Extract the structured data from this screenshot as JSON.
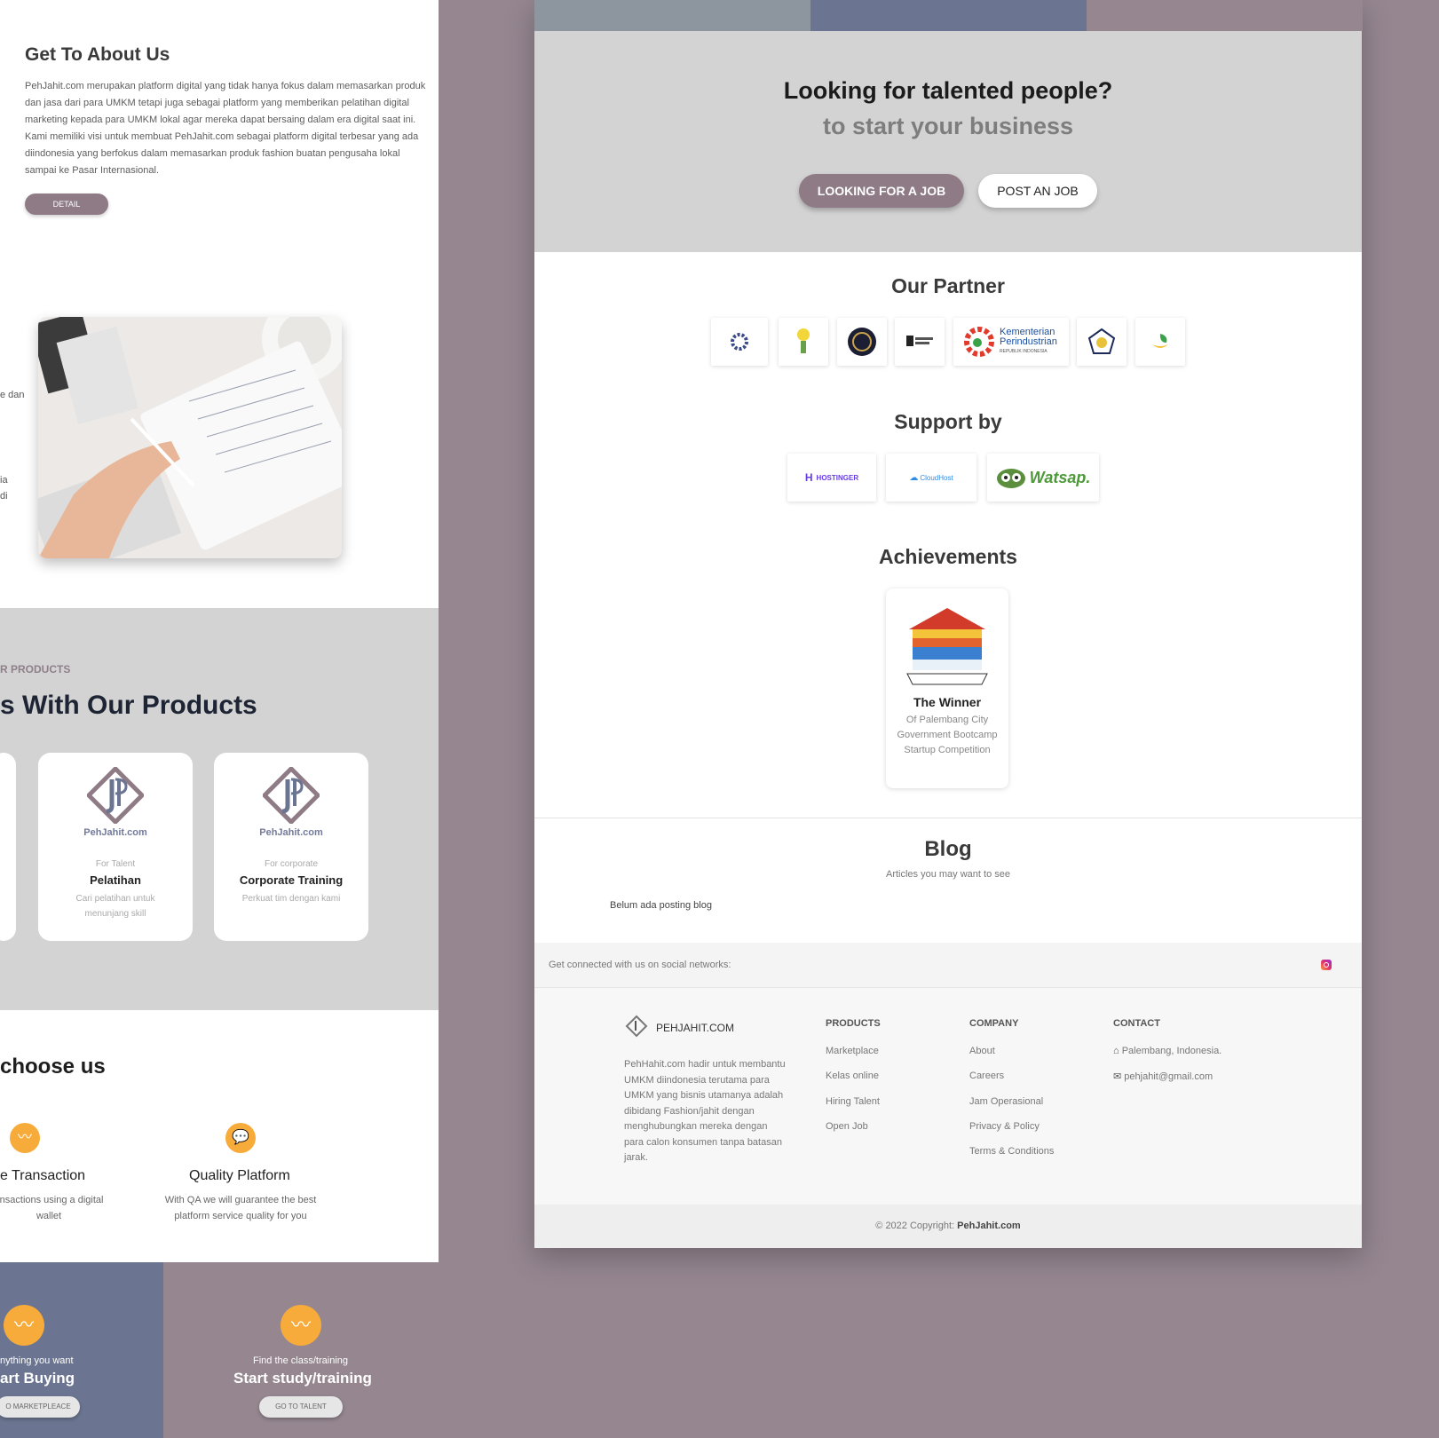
{
  "about": {
    "title": "Get To About Us",
    "text": "PehJahit.com merupakan platform digital yang tidak hanya fokus dalam memasarkan produk dan jasa dari para UMKM tetapi juga sebagai platform yang memberikan pelatihan digital marketing kepada para UMKM lokal agar mereka dapat bersaing dalam era digital saat ini. Kami memiliki visi untuk membuat PehJahit.com sebagai platform digital terbesar yang ada diindonesia yang berfokus dalam memasarkan produk fashion buatan pengusaha lokal sampai ke Pasar Internasional.",
    "detail_button": "DETAIL",
    "fragments": [
      "e dan",
      "ia",
      "di"
    ]
  },
  "products": {
    "eyebrow": "R PRODUCTS",
    "heading": "s With Our Products",
    "cards": [
      {
        "brand": "PehJahit.com",
        "kicker": "For Talent",
        "title": "Pelatihan",
        "desc": "Cari pelatihan untuk menunjang skill"
      },
      {
        "brand": "PehJahit.com",
        "kicker": "For corporate",
        "title": "Corporate Training",
        "desc": "Perkuat tim dengan kami"
      }
    ]
  },
  "why": {
    "heading": "choose us",
    "features": [
      {
        "title": "e Transaction",
        "desc": "ansactions using a digital wallet"
      },
      {
        "title": "Quality Platform",
        "desc": "With QA we will guarantee the best platform service quality for you"
      }
    ]
  },
  "cta": [
    {
      "small": "nything you want",
      "big": "art Buying",
      "button": "O MARKETPLEACE"
    },
    {
      "small": "Find the class/training",
      "big": "Start study/training",
      "button": "GO TO TALENT"
    }
  ],
  "hero": {
    "title": "Looking for talented people?",
    "subtitle": "to start your business",
    "btn_job": "LOOKING FOR A JOB",
    "btn_post": "POST AN JOB"
  },
  "partner": {
    "heading": "Our Partner",
    "kementerian_line1": "Kementerian",
    "kementerian_line2": "Perindustrian",
    "kementerian_line3": "REPUBLIK INDONESIA"
  },
  "support": {
    "heading": "Support by",
    "hostinger": "HOSTINGER",
    "cloudhost": "CloudHost",
    "watsap": "Watsap."
  },
  "achievements": {
    "heading": "Achievements",
    "title": "The Winner",
    "desc": "Of Palembang City Government Bootcamp Startup Competition"
  },
  "blog": {
    "heading": "Blog",
    "subtitle": "Articles you may want to see",
    "empty": "Belum ada posting blog"
  },
  "social": {
    "text": "Get connected with us on social networks:"
  },
  "footer": {
    "brand": "PEHJAHIT.COM",
    "about": "PehHahit.com hadir untuk membantu UMKM diindonesia terutama para UMKM yang bisnis utamanya adalah dibidang Fashion/jahit dengan menghubungkan mereka dengan para calon konsumen tanpa batasan jarak.",
    "products_heading": "PRODUCTS",
    "products": [
      "Marketplace",
      "Kelas online",
      "Hiring Talent",
      "Open Job"
    ],
    "company_heading": "COMPANY",
    "company": [
      "About",
      "Careers",
      "Jam Operasional",
      "Privacy & Policy",
      "Terms & Conditions"
    ],
    "contact_heading": "CONTACT",
    "address": "Palembang, Indonesia.",
    "email": "pehjahit@gmail.com",
    "copyright_prefix": "© 2022 Copyright:",
    "copyright_brand": "PehJahit.com"
  },
  "colors": {
    "mauve": "#8e7b86",
    "blue": "#6b7591",
    "gray": "#d3d3d3",
    "accent": "#f7ab3a"
  }
}
